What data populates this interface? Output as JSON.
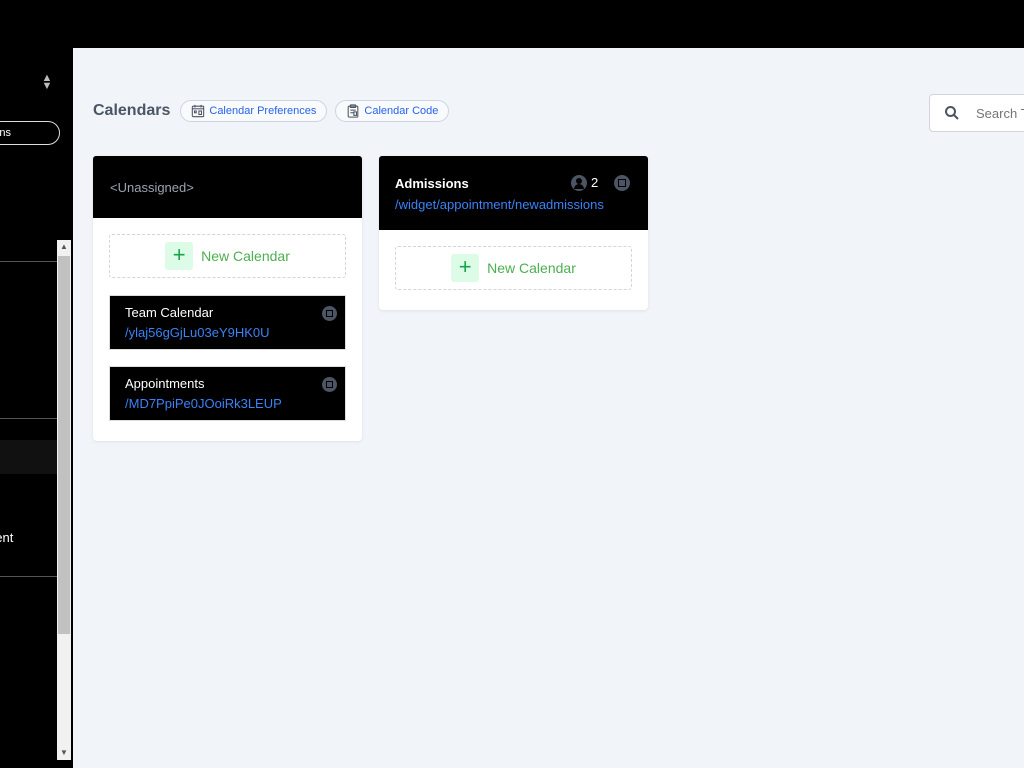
{
  "sidebar": {
    "pill_label": "ns",
    "partial_item_label": "nent"
  },
  "header": {
    "title": "Calendars",
    "preferences_label": "Calendar Preferences",
    "code_label": "Calendar Code"
  },
  "search": {
    "placeholder": "Search T"
  },
  "columns": [
    {
      "title": "<Unassigned>",
      "new_calendar_label": "New Calendar",
      "calendars": [
        {
          "name": "Team Calendar",
          "link": "/ylaj56gGjLu03eY9HK0U"
        },
        {
          "name": "Appointments",
          "link": "/MD7PpiPe0JOoiRk3LEUP"
        }
      ]
    },
    {
      "title": "Admissions",
      "link": "/widget/appointment/newadmissions",
      "member_count": "2",
      "new_calendar_label": "New Calendar"
    }
  ],
  "colors": {
    "accent_blue": "#3b82f6",
    "new_calendar_green": "#4caf50",
    "background": "#f1f5f9"
  }
}
